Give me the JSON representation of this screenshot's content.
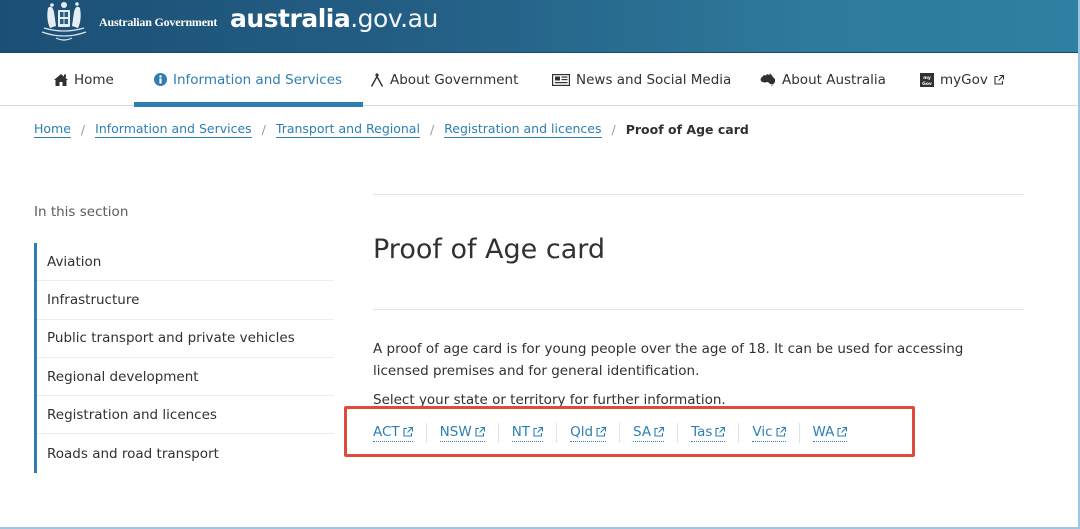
{
  "header": {
    "gov_name": "Australian Government",
    "site_logo_bold": "australia",
    "site_logo_light": ".gov.au"
  },
  "nav": {
    "items": [
      {
        "label": "Home",
        "icon": "home-icon",
        "active": false
      },
      {
        "label": "Information and Services",
        "icon": "info-circle-icon",
        "active": true
      },
      {
        "label": "About Government",
        "icon": "compass-icon",
        "active": false
      },
      {
        "label": "News and Social Media",
        "icon": "newspaper-icon",
        "active": false
      },
      {
        "label": "About Australia",
        "icon": "australia-map-icon",
        "active": false
      },
      {
        "label": "myGov",
        "icon": "mygov-icon",
        "external": true,
        "active": false
      }
    ]
  },
  "breadcrumb": {
    "links": [
      "Home",
      "Information and Services",
      "Transport and Regional",
      "Registration and licences"
    ],
    "current": "Proof of Age card",
    "separator": "/"
  },
  "sidebar": {
    "label": "In this section",
    "items": [
      "Aviation",
      "Infrastructure",
      "Public transport and private vehicles",
      "Regional development",
      "Registration and licences",
      "Roads and road transport"
    ]
  },
  "main": {
    "title": "Proof of Age card",
    "intro": "A proof of age card is for young people over the age of 18. It can be used for accessing licensed premises and for general identification.",
    "select_text": "Select your state or territory for further information.",
    "states": [
      "ACT",
      "NSW",
      "NT",
      "Qld",
      "SA",
      "Tas",
      "Vic",
      "WA"
    ]
  },
  "colors": {
    "brand_link": "#2e7fb1",
    "header_start": "#1c4f74",
    "header_end": "#2f80a2",
    "highlight": "#e04a3a"
  }
}
